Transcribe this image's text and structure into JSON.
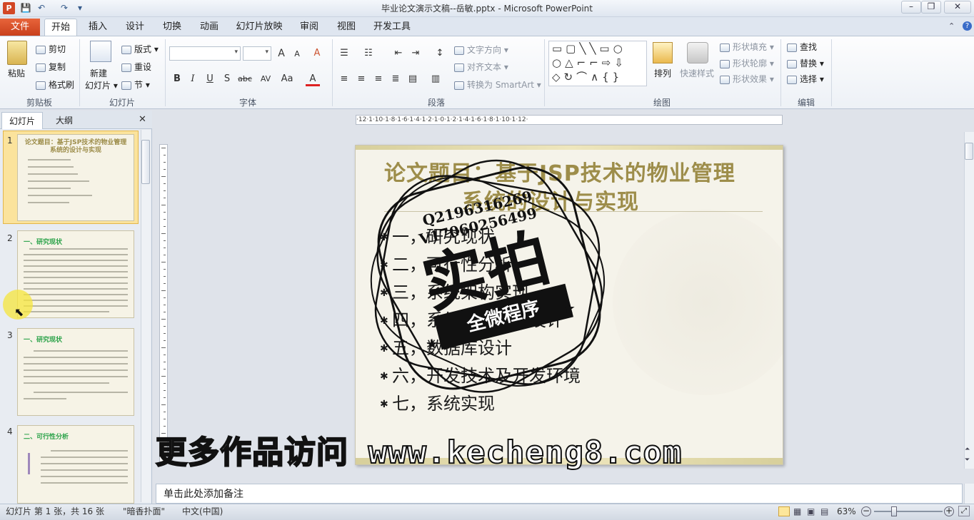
{
  "window": {
    "title": "毕业论文演示文稿--岳敏.pptx - Microsoft PowerPoint",
    "minimize": "–",
    "maximize": "❐",
    "close": "✕"
  },
  "quick_access": {
    "save": "💾",
    "undo": "↶",
    "redo": "↷",
    "customize": "▾"
  },
  "tabs": {
    "file": "文件",
    "items": [
      "开始",
      "插入",
      "设计",
      "切换",
      "动画",
      "幻灯片放映",
      "审阅",
      "视图",
      "开发工具"
    ]
  },
  "ribbon": {
    "clipboard": {
      "label": "剪贴板",
      "paste": "粘贴",
      "cut": "剪切",
      "copy": "复制",
      "format_painter": "格式刷"
    },
    "slides": {
      "label": "幻灯片",
      "new_slide_1": "新建",
      "new_slide_2": "幻灯片",
      "layout": "版式",
      "reset": "重设",
      "section": "节"
    },
    "font": {
      "label": "字体",
      "bold": "B",
      "italic": "I",
      "underline": "U",
      "shadow": "S",
      "strike": "abc",
      "spacing": "AV",
      "case": "Aa",
      "color": "A",
      "grow": "A",
      "shrink": "A",
      "clear": "A"
    },
    "paragraph": {
      "label": "段落",
      "text_direction": "文字方向",
      "align_text": "对齐文本",
      "smartart": "转换为 SmartArt"
    },
    "drawing": {
      "label": "绘图",
      "arrange": "排列",
      "quick_styles": "快速样式",
      "shape_fill": "形状填充",
      "shape_outline": "形状轮廓",
      "shape_effects": "形状效果"
    },
    "editing": {
      "label": "编辑",
      "find": "查找",
      "replace": "替换",
      "select": "选择"
    }
  },
  "panel": {
    "tab_slides": "幻灯片",
    "tab_outline": "大纲",
    "close": "✕"
  },
  "thumbnails": [
    {
      "num": "1",
      "title": "论文题目：基于JSP技术的物业管理系统的设计与实现"
    },
    {
      "num": "2",
      "title": "一、研究现状"
    },
    {
      "num": "3",
      "title": "一、研究现状"
    },
    {
      "num": "4",
      "title": "二、可行性分析"
    }
  ],
  "slide": {
    "title_line1": "论文题目：基于JSP技术的物业管理",
    "title_line2": "系统的设计与实现",
    "bullets": [
      "一，研究现状",
      "二，可行性分析",
      "三，系统架构实现",
      "四，系统功能模块设计",
      "五，数据库设计",
      "六，开发技术及开发环境",
      "七，系统实现"
    ],
    "bullet_marker": "✱"
  },
  "overlay": {
    "stamp_line1": "Q2196316269",
    "stamp_line2": "V17060256499",
    "stamp_big": "实拍",
    "stamp_band": "全微程序",
    "watermark": "更多作品访问 www.kecheng8.com"
  },
  "ruler": {
    "h_ticks": "·12·1·10·1·8·1·6·1·4·1·2·1·0·1·2·1·4·1·6·1·8·1·10·1·12·"
  },
  "notes": {
    "placeholder": "单击此处添加备注"
  },
  "status": {
    "slide_info": "幻灯片 第 1 张，共 16 张",
    "theme": "\"暗香扑面\"",
    "language": "中文(中国)",
    "zoom": "63%",
    "zoom_level_percent": 63
  }
}
